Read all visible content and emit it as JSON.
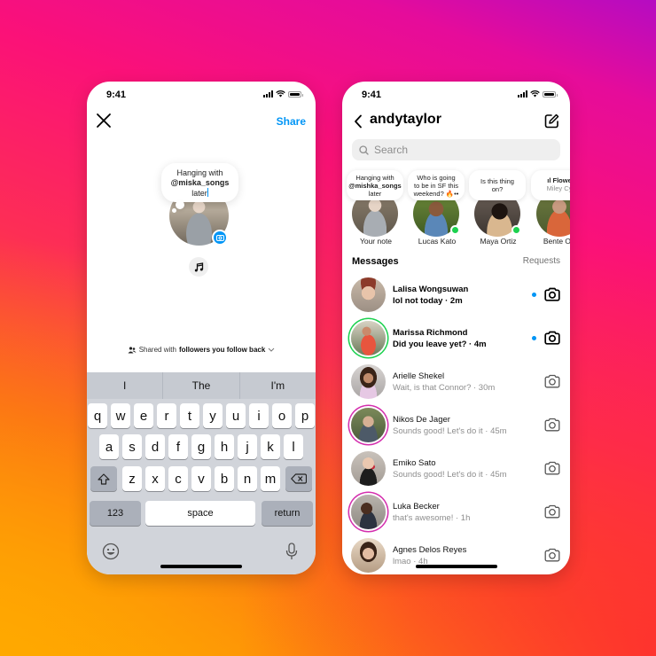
{
  "colors": {
    "accent": "#0095f6",
    "online": "#1cd14f",
    "story_ring": "#d42fae"
  },
  "left_phone": {
    "status_time": "9:41",
    "close_icon": "close-icon",
    "share_label": "Share",
    "note": {
      "line1": "Hanging with",
      "mention": "@miska_songs",
      "line3": "later"
    },
    "camera_badge_icon": "camera-icon",
    "music_icon": "music-note-icon",
    "audience": {
      "prefix": "Shared with",
      "value": "followers you follow back"
    },
    "keyboard": {
      "suggestions": [
        "I",
        "The",
        "I'm"
      ],
      "row1": [
        "q",
        "w",
        "e",
        "r",
        "t",
        "y",
        "u",
        "i",
        "o",
        "p"
      ],
      "row2": [
        "a",
        "s",
        "d",
        "f",
        "g",
        "h",
        "j",
        "k",
        "l"
      ],
      "row3": [
        "z",
        "x",
        "c",
        "v",
        "b",
        "n",
        "m"
      ],
      "numbers_label": "123",
      "space_label": "space",
      "return_label": "return"
    }
  },
  "right_phone": {
    "status_time": "9:41",
    "title": "andytaylor",
    "search_placeholder": "Search",
    "notes": [
      {
        "name": "Your note",
        "line1": "Hanging with",
        "line2": "@mishka_songs",
        "line3": "later",
        "online": false
      },
      {
        "name": "Lucas Kato",
        "line1": "Who is going",
        "line2": "to be in SF this",
        "line3": "weekend? 🔥••",
        "online": true
      },
      {
        "name": "Maya Ortiz",
        "line1": "Is this thing",
        "line2": "on?",
        "line3": "",
        "online": true
      },
      {
        "name": "Bente Oth",
        "line1": "ıl Flowe",
        "line2": "Miley Cy",
        "line3": "",
        "online": false
      }
    ],
    "messages_header": "Messages",
    "requests_label": "Requests",
    "threads": [
      {
        "name": "Lalisa Wongsuwan",
        "message": "lol not today · 2m",
        "unread": true,
        "ring": "none"
      },
      {
        "name": "Marissa Richmond",
        "message": "Did you leave yet? · 4m",
        "unread": true,
        "ring": "green"
      },
      {
        "name": "Arielle Shekel",
        "message": "Wait, is that Connor? · 30m",
        "unread": false,
        "ring": "none"
      },
      {
        "name": "Nikos De Jager",
        "message": "Sounds good! Let's do it · 45m",
        "unread": false,
        "ring": "story"
      },
      {
        "name": "Emiko Sato",
        "message": "Sounds good! Let's do it · 45m",
        "unread": false,
        "ring": "none"
      },
      {
        "name": "Luka Becker",
        "message": "that's awesome! · 1h",
        "unread": false,
        "ring": "story"
      },
      {
        "name": "Agnes Delos Reyes",
        "message": "lmao · 4h",
        "unread": false,
        "ring": "none"
      }
    ]
  }
}
